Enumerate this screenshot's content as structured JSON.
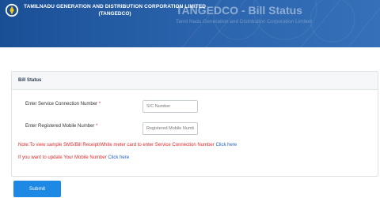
{
  "header": {
    "org_name": "TAMILNADU GENERATION AND DISTRIBUTION CORPORATION LIMITED",
    "org_abbr": "(TANGEDCO)",
    "page_title": "TANGEDCO - Bill Status",
    "page_subtitle": "Tamil Nadu Generation and Distribution Corporation Limited"
  },
  "form": {
    "section_title": "Bill Status",
    "service_label": "Enter Service Connection Number",
    "service_required": "*",
    "service_placeholder": "S/C Number",
    "mobile_label": "Enter Registered Mobile Number",
    "mobile_required": "*",
    "mobile_placeholder": "Registered Mobile Numbe",
    "note_text": "Note:To view sample SMS/Bill Receipt/White meter card to enter Service Connection Number",
    "note_link": "Click here",
    "update_text": "If you want to update Your Mobile Number",
    "update_link": "Click here",
    "submit_label": "Submit"
  },
  "colors": {
    "banner": "#2a63ab",
    "note_red": "#e02b2b",
    "link_blue": "#1f5fbf",
    "submit_blue": "#1e88e5"
  }
}
